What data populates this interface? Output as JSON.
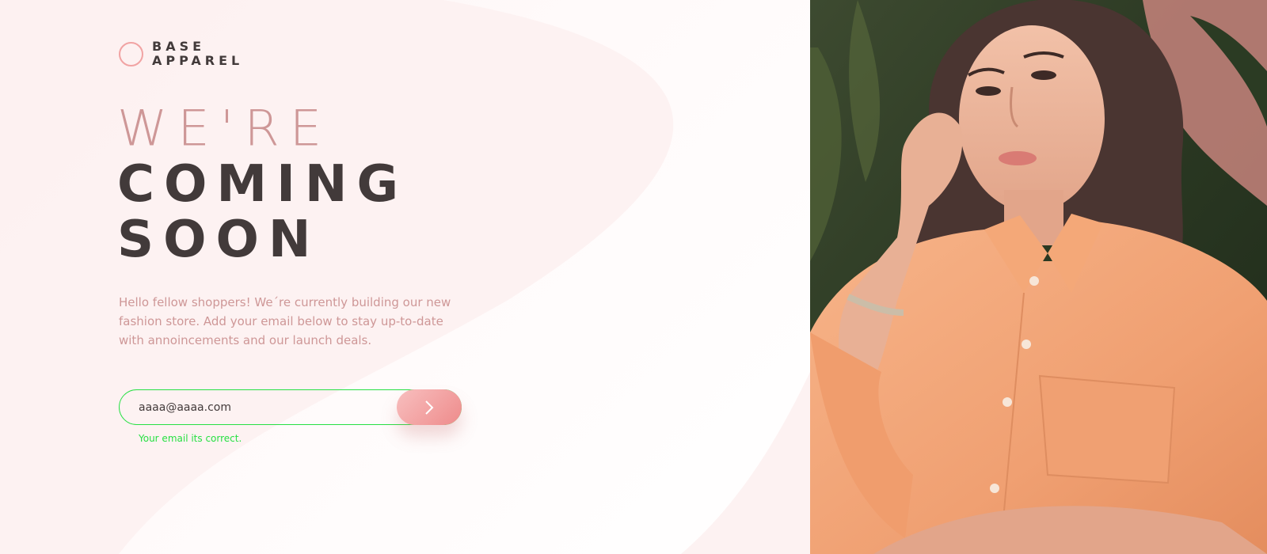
{
  "brand": {
    "line1": "BASE",
    "line2": "APPAREL"
  },
  "headline": {
    "line1": "WE'RE",
    "line2": "COMING",
    "line3": "SOON"
  },
  "description": "Hello fellow shoppers! We´re currently building our new fashion store. Add your email below to stay up-to-date with annoincements and our launch deals.",
  "form": {
    "email_value": "aaaa@aaaa.com",
    "submit_icon": "chevron-right-icon",
    "validation_message": "Your email its correct."
  },
  "colors": {
    "accent_pink": "#ce9797",
    "dark_text": "#423a3a",
    "button_gradient_start": "#f8bfbf",
    "button_gradient_end": "#ee8b8b",
    "success_green": "#27e043"
  }
}
